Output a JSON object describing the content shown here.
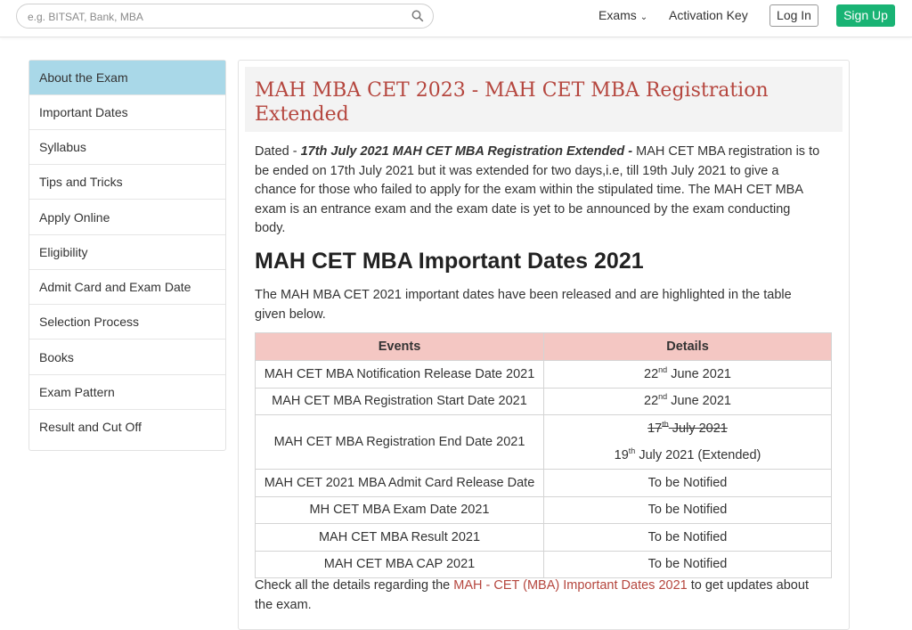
{
  "header": {
    "search_placeholder": "e.g. BITSAT, Bank, MBA",
    "nav_exams": "Exams",
    "nav_activation_key": "Activation Key",
    "login_label": "Log In",
    "signup_label": "Sign Up",
    "signup_color": "#19b374"
  },
  "sidebar": {
    "items": [
      {
        "label": "About the Exam"
      },
      {
        "label": "Important Dates"
      },
      {
        "label": "Syllabus"
      },
      {
        "label": "Tips and Tricks"
      },
      {
        "label": "Apply Online"
      },
      {
        "label": "Eligibility"
      },
      {
        "label": "Admit Card and Exam Date"
      },
      {
        "label": "Selection Process"
      },
      {
        "label": "Books"
      },
      {
        "label": "Exam Pattern"
      },
      {
        "label": "Result and Cut Off"
      }
    ],
    "active_color": "#a9d8e8"
  },
  "main": {
    "title": "MAH MBA CET 2023 - MAH CET MBA Registration Extended",
    "title_color": "#b5463e",
    "intro_prefix": "Dated - ",
    "intro_bold": "17th July 2021 MAH CET MBA Registration Extended - ",
    "intro_text": "MAH CET MBA registration is to be ended on 17th July 2021 but it was extended for two days,i.e, till 19th July 2021 to give a chance for those who failed to apply for the exam within the stipulated time. The MAH CET MBA exam is an entrance exam and the exam date is yet to be announced by the exam conducting body.",
    "section_heading": "MAH CET MBA Important Dates 2021",
    "section_intro": "The MAH MBA CET 2021 important dates have been released and are highlighted in the table given below.",
    "table": {
      "header_color": "#f4c7c3",
      "col_events": "Events",
      "col_details": "Details",
      "rows": [
        {
          "event": "MAH CET MBA Notification Release Date 2021",
          "d_num": "22",
          "d_sup": "nd",
          "d_rest": " June 2021"
        },
        {
          "event": "MAH CET MBA Registration Start Date 2021",
          "d_num": "22",
          "d_sup": "nd",
          "d_rest": " June 2021"
        },
        {
          "event": "MAH CET MBA Registration End Date 2021",
          "old_num": "17",
          "old_sup": "th",
          "old_rest": " July 2021",
          "new_num": "19",
          "new_sup": "th",
          "new_rest": " July 2021 (Extended)"
        },
        {
          "event": "MAH CET 2021 MBA Admit Card Release Date",
          "details": "To be Notified"
        },
        {
          "event": "MH CET MBA Exam Date 2021",
          "details": "To be Notified"
        },
        {
          "event": "MAH CET MBA Result 2021",
          "details": "To be Notified"
        },
        {
          "event": "MAH CET MBA CAP 2021",
          "details": "To be Notified"
        }
      ]
    },
    "footer_prefix": "Check all the details regarding the ",
    "footer_link": "MAH - CET (MBA) Important Dates 2021",
    "footer_suffix": " to get updates about the exam."
  }
}
